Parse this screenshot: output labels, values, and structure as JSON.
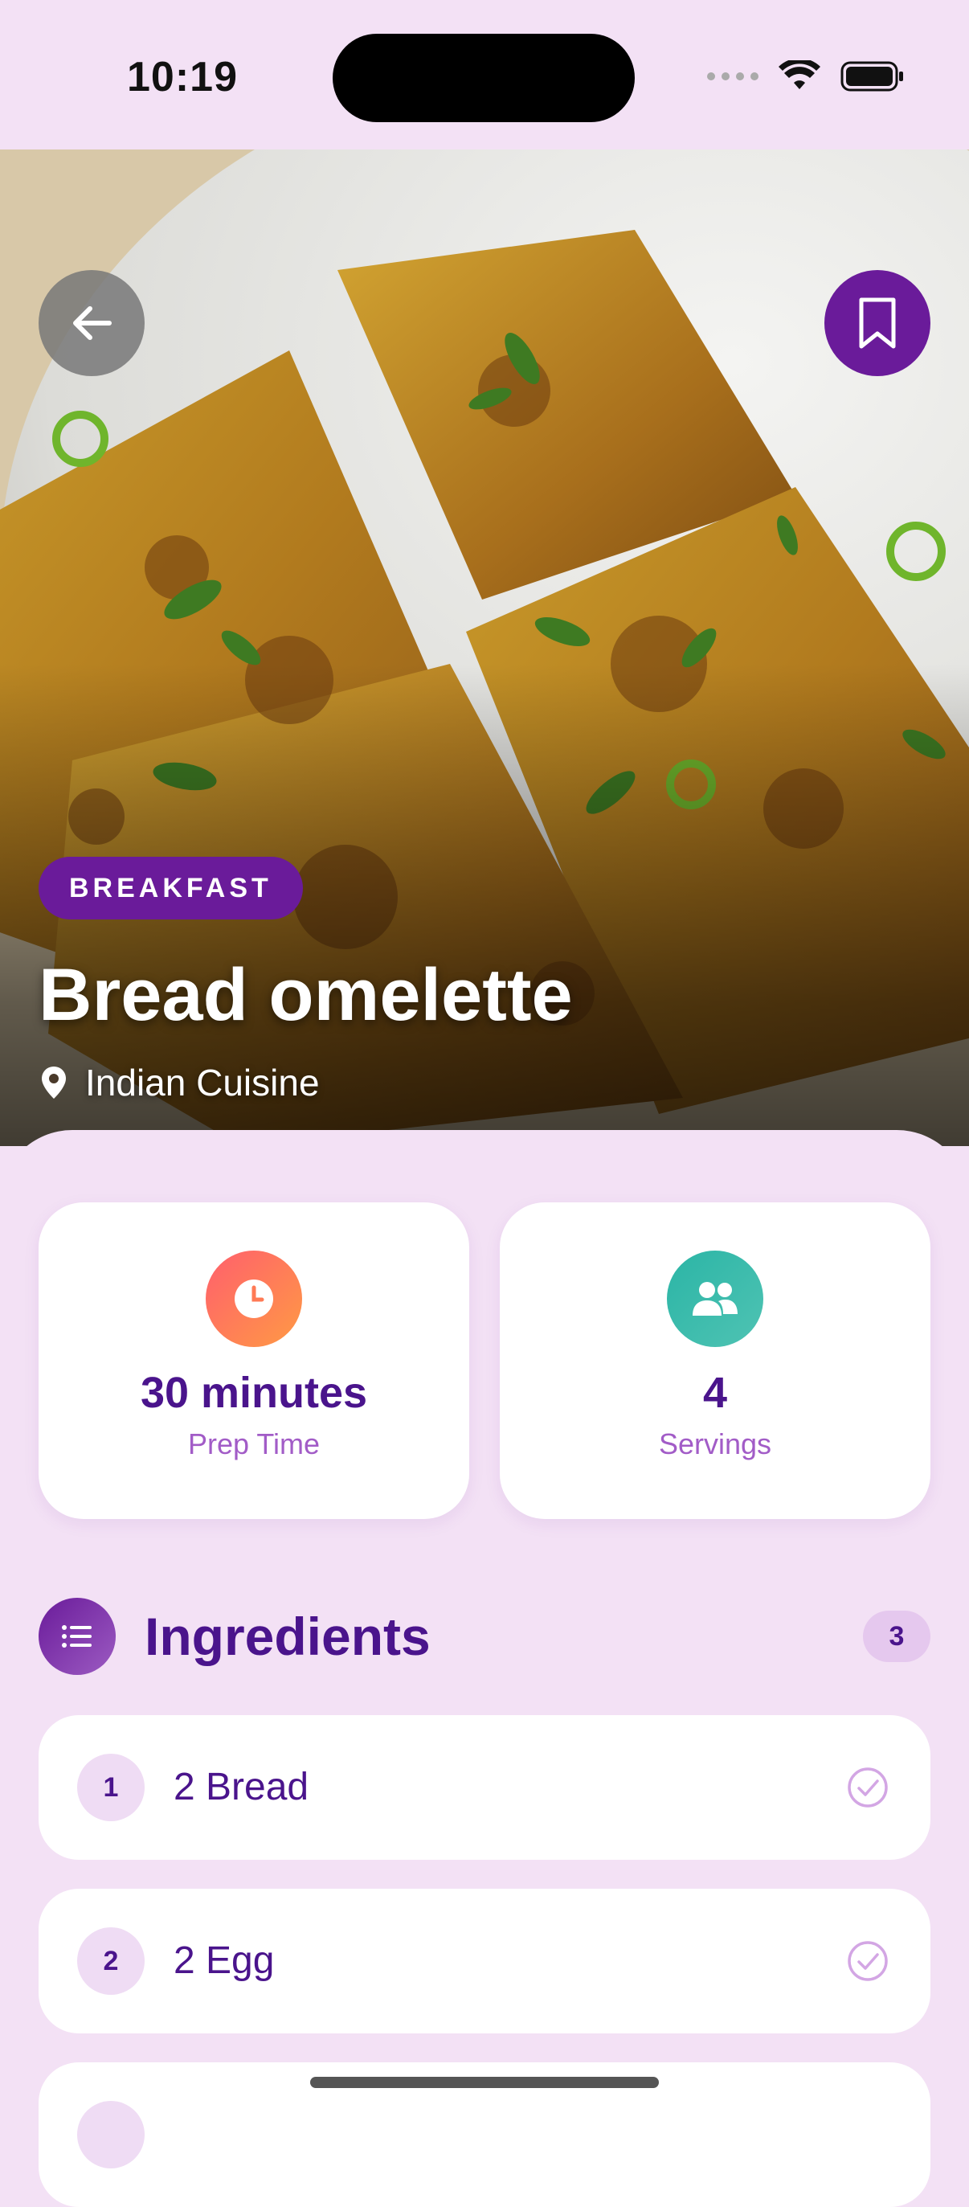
{
  "status_bar": {
    "time": "10:19"
  },
  "hero": {
    "back_icon": "arrow-left-icon",
    "bookmark_icon": "bookmark-icon",
    "category": "BREAKFAST",
    "title": "Bread omelette",
    "cuisine": "Indian Cuisine",
    "cuisine_icon": "location-pin-icon"
  },
  "stats": {
    "prep_time": {
      "value": "30 minutes",
      "label": "Prep Time",
      "icon": "clock-icon"
    },
    "servings": {
      "value": "4",
      "label": "Servings",
      "icon": "people-icon"
    }
  },
  "ingredients": {
    "title": "Ingredients",
    "count": "3",
    "icon": "list-icon",
    "items": [
      {
        "number": "1",
        "text": "2 Bread"
      },
      {
        "number": "2",
        "text": "2 Egg"
      }
    ]
  },
  "colors": {
    "accent": "#6a1b9a",
    "title_text": "#4a148c",
    "background": "#f3e1f5"
  }
}
